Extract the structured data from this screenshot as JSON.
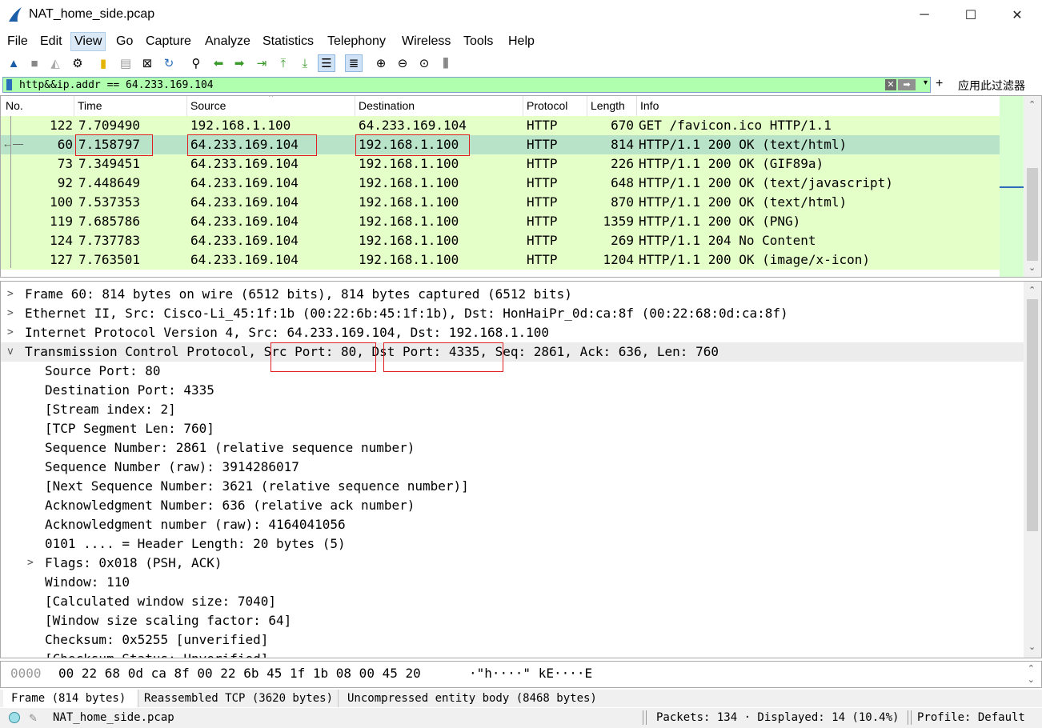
{
  "window": {
    "title": "NAT_home_side.pcap",
    "minimize": "─",
    "maximize": "☐",
    "close": "✕"
  },
  "menu": [
    "File",
    "Edit",
    "View",
    "Go",
    "Capture",
    "Analyze",
    "Statistics",
    "Telephony",
    "Wireless",
    "Tools",
    "Help"
  ],
  "filter": {
    "value": "http&&ip.addr == 64.233.169.104",
    "clear": "✕",
    "apply": "➡",
    "dropdown": "▾",
    "add": "+",
    "action_label": "应用此过滤器"
  },
  "packet_list": {
    "columns": [
      "No.",
      "Time",
      "Source",
      "Destination",
      "Protocol",
      "Length",
      "Info"
    ],
    "rows": [
      {
        "no": "122",
        "time": "7.709490",
        "source": "192.168.1.100",
        "destination": "64.233.169.104",
        "protocol": "HTTP",
        "length": "670",
        "info": "GET /favicon.ico HTTP/1.1"
      },
      {
        "no": "60",
        "time": "7.158797",
        "source": "64.233.169.104",
        "destination": "192.168.1.100",
        "protocol": "HTTP",
        "length": "814",
        "info": "HTTP/1.1 200 OK  (text/html)"
      },
      {
        "no": "73",
        "time": "7.349451",
        "source": "64.233.169.104",
        "destination": "192.168.1.100",
        "protocol": "HTTP",
        "length": "226",
        "info": "HTTP/1.1 200 OK  (GIF89a)"
      },
      {
        "no": "92",
        "time": "7.448649",
        "source": "64.233.169.104",
        "destination": "192.168.1.100",
        "protocol": "HTTP",
        "length": "648",
        "info": "HTTP/1.1 200 OK  (text/javascript)"
      },
      {
        "no": "100",
        "time": "7.537353",
        "source": "64.233.169.104",
        "destination": "192.168.1.100",
        "protocol": "HTTP",
        "length": "870",
        "info": "HTTP/1.1 200 OK  (text/html)"
      },
      {
        "no": "119",
        "time": "7.685786",
        "source": "64.233.169.104",
        "destination": "192.168.1.100",
        "protocol": "HTTP",
        "length": "1359",
        "info": "HTTP/1.1 200 OK  (PNG)"
      },
      {
        "no": "124",
        "time": "7.737783",
        "source": "64.233.169.104",
        "destination": "192.168.1.100",
        "protocol": "HTTP",
        "length": "269",
        "info": "HTTP/1.1 204 No Content"
      },
      {
        "no": "127",
        "time": "7.763501",
        "source": "64.233.169.104",
        "destination": "192.168.1.100",
        "protocol": "HTTP",
        "length": "1204",
        "info": "HTTP/1.1 200 OK  (image/x-icon)"
      }
    ],
    "selected_no": "60"
  },
  "details": {
    "top_lines": [
      {
        "expander": ">",
        "text": "Frame 60: 814 bytes on wire (6512 bits), 814 bytes captured (6512 bits)"
      },
      {
        "expander": ">",
        "text": "Ethernet II, Src: Cisco-Li_45:1f:1b (00:22:6b:45:1f:1b), Dst: HonHaiPr_0d:ca:8f (00:22:68:0d:ca:8f)"
      },
      {
        "expander": ">",
        "text": "Internet Protocol Version 4, Src: 64.233.169.104, Dst: 192.168.1.100"
      }
    ],
    "tcp": {
      "expander": "v",
      "prefix": "Transmission Control Protocol, ",
      "src_port": "Src Port: 80",
      "sep": ", ",
      "dst_port": "Dst Port: 4335",
      "suffix": ", Seq: 2861, Ack: 636, Len: 760"
    },
    "tcp_fields": [
      {
        "text": "Source Port: 80"
      },
      {
        "text": "Destination Port: 4335"
      },
      {
        "text": "[Stream index: 2]"
      },
      {
        "text": "[TCP Segment Len: 760]"
      },
      {
        "text": "Sequence Number: 2861    (relative sequence number)"
      },
      {
        "text": "Sequence Number (raw): 3914286017"
      },
      {
        "text": "[Next Sequence Number: 3621    (relative sequence number)]"
      },
      {
        "text": "Acknowledgment Number: 636    (relative ack number)"
      },
      {
        "text": "Acknowledgment number (raw): 4164041056"
      },
      {
        "text": "0101 .... = Header Length: 20 bytes (5)"
      },
      {
        "text": "Flags: 0x018 (PSH, ACK)",
        "expander": ">"
      },
      {
        "text": "Window: 110"
      },
      {
        "text": "[Calculated window size: 7040]"
      },
      {
        "text": "[Window size scaling factor: 64]"
      },
      {
        "text": "Checksum: 0x5255 [unverified]"
      },
      {
        "text": "[Checksum Status: Unverified]"
      }
    ]
  },
  "bytes": {
    "offset": "0000",
    "hex": "00 22 68 0d ca 8f 00 22  6b 45 1f 1b 08 00 45 20",
    "ascii": "·\"h····\" kE····E "
  },
  "byte_tabs": [
    "Frame (814 bytes)",
    "Reassembled TCP (3620 bytes)",
    "Uncompressed entity body (8468 bytes)"
  ],
  "status": {
    "file": "NAT_home_side.pcap",
    "packets": "Packets: 134 · Displayed: 14 (10.4%)",
    "profile": "Profile: Default"
  },
  "colors": {
    "row_bg": "#e4ffc7",
    "selected_row": "#b8e3c8",
    "filter_bg": "#afffaf",
    "highlight_box": "#e02020"
  }
}
